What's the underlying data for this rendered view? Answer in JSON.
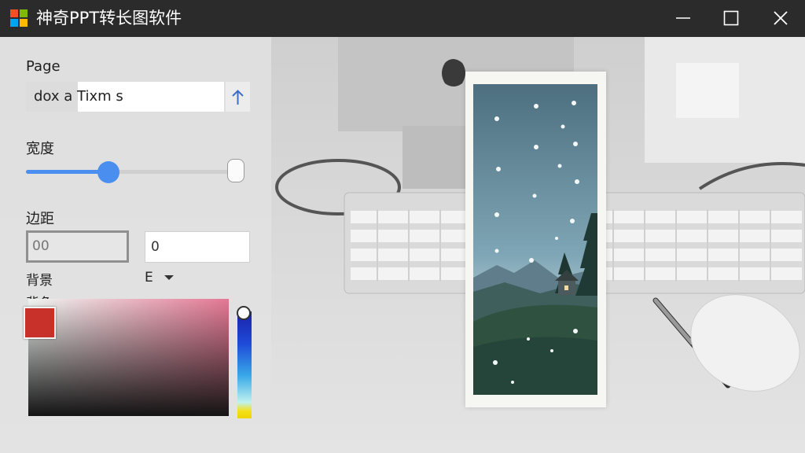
{
  "window": {
    "title": "神奇PPT转长图软件",
    "accent": "#4a8ff0"
  },
  "panel": {
    "page_label": "Page",
    "page_value": "dox  a Tixm s",
    "width_label": "宽度",
    "width_slider": {
      "value": 0.4
    },
    "margin_label": "边距",
    "margin_value_1": "00",
    "margin_value_2": "0",
    "background_label": "背景",
    "background_dropdown_value": "E",
    "color_label": "背色",
    "selected_color": "#c8312a"
  },
  "icons": [
    "app-logo-icon",
    "minimize-icon",
    "maximize-icon",
    "close-icon",
    "arrow-up-icon",
    "chevron-down-icon"
  ]
}
